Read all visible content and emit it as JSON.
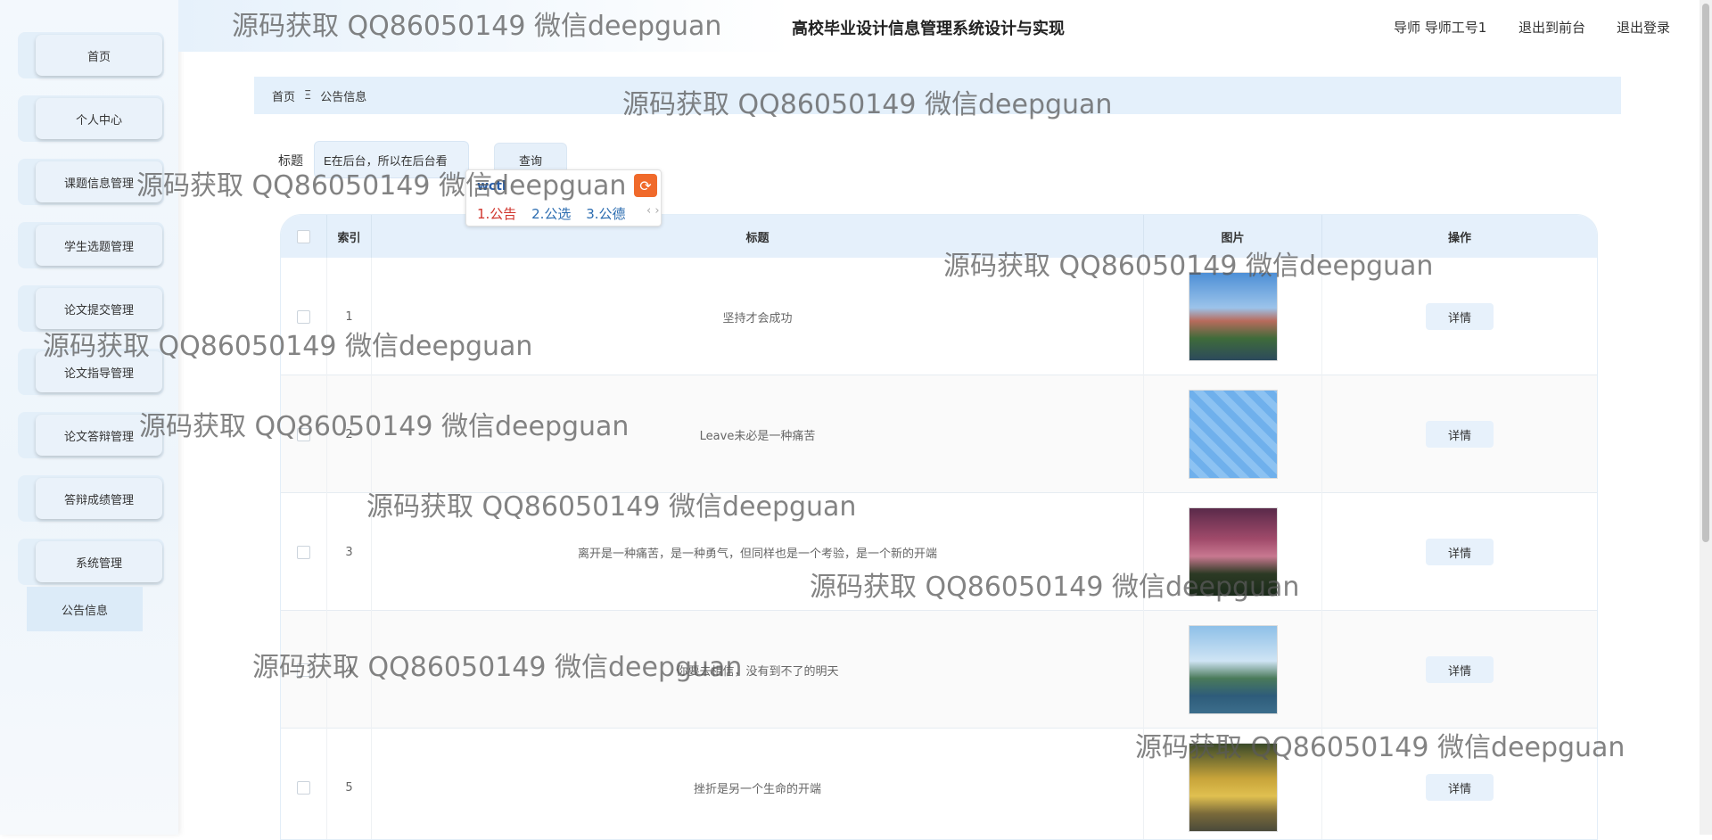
{
  "sidebar": {
    "items": [
      {
        "label": "首页"
      },
      {
        "label": "个人中心"
      },
      {
        "label": "课题信息管理"
      },
      {
        "label": "学生选题管理"
      },
      {
        "label": "论文提交管理"
      },
      {
        "label": "论文指导管理"
      },
      {
        "label": "论文答辩管理"
      },
      {
        "label": "答辩成绩管理"
      },
      {
        "label": "系统管理"
      }
    ],
    "submenu": {
      "label": "公告信息"
    }
  },
  "header": {
    "title": "高校毕业设计信息管理系统设计与实现",
    "user": "导师 导师工号1",
    "to_front": "退出到前台",
    "logout": "退出登录"
  },
  "breadcrumb": {
    "home": "首页",
    "separator": "Ξ",
    "current": "公告信息"
  },
  "search": {
    "label": "标题",
    "value": "E在后台，所以在后台看",
    "button": "查询"
  },
  "ime": {
    "composition": "wctl",
    "candidates": [
      "1.公告",
      "2.公选",
      "3.公德"
    ],
    "arrows": "‹ ›"
  },
  "table": {
    "columns": [
      "索引",
      "标题",
      "图片",
      "操作"
    ],
    "rows": [
      {
        "index": "1",
        "title": "坚持才会成功",
        "image": "campus-lake",
        "action": "详情"
      },
      {
        "index": "2",
        "title": "Leave未必是一种痛苦",
        "image": "blue-pattern",
        "action": "详情"
      },
      {
        "index": "3",
        "title": "离开是一种痛苦，是一种勇气，但同样也是一个考验，是一个新的开端",
        "image": "palm-trees-dusk",
        "action": "详情"
      },
      {
        "index": "4",
        "title": "你要去相信，没有到不了的明天",
        "image": "campus-aerial",
        "action": "详情"
      },
      {
        "index": "5",
        "title": "挫折是另一个生命的开端",
        "image": "autumn-ginkgo",
        "action": "详情"
      }
    ]
  },
  "watermark": "源码获取 QQ86050149 微信deepguan",
  "colors": {
    "accent": "#e4f0fb",
    "sidebar": "#eef5fb",
    "button": "#e7f1fb"
  }
}
